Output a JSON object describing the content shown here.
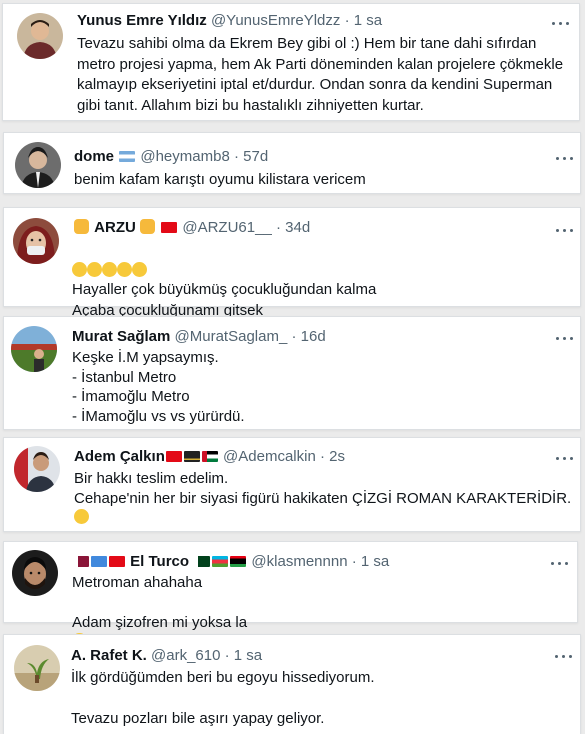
{
  "tweets": [
    {
      "name": "Yunus Emre Yıldız",
      "handle": "@YunusEmreYldzz",
      "time": "1 sa",
      "text": "Tevazu sahibi olma da Ekrem Bey gibi ol :) Hem bir tane dahi sıfırdan metro projesi yapma, hem Ak Parti döneminden kalan projelere çökmekle kalmayıp ekseriyetini iptal et/durdur. Ondan sonra da kendini Superman gibi tanıt. Allahım bizi bu hastalıklı zihniyetten kurtar."
    },
    {
      "name": "dome",
      "handle": "@heymamb8",
      "time": "57d",
      "text": "benim kafam karıştı oyumu kilistara vericem"
    },
    {
      "name": "ARZU",
      "handle": "@ARZU61__",
      "time": "34d",
      "text_line1": "Hayaller çok büyükmüş çocukluğundan kalma",
      "text_line2": "Açaba çocukluğunamı gitsek"
    },
    {
      "name": "Murat Sağlam",
      "handle": "@MuratSaglam_",
      "time": "16d",
      "text": "Keşke İ.M yapsaymış.\n- İstanbul Metro\n- İmamoğlu Metro\n- İMamoğlu vs vs yürürdü."
    },
    {
      "name": "Adem Çalkın",
      "handle": "@Ademcalkin",
      "time": "2s",
      "text": "Bir hakkı teslim edelim.\nCehape'nin her bir siyasi figürü hakikaten ÇİZGİ ROMAN KARAKTERİDİR."
    },
    {
      "name": "El Turco",
      "handle": "@klasmennnn",
      "time": "1 sa",
      "text_line1": "Metroman ahahaha",
      "text_line2": "Adam şizofren mi yoksa la"
    },
    {
      "name": "A. Rafet K.",
      "handle": "@ark_610",
      "time": "1 sa",
      "text_line1": "İlk gördüğümden beri bu egoyu hissediyorum.",
      "text_line2": "Tevazu pozları bile aşırı yapay geliyor."
    }
  ],
  "separator": "·",
  "colors": {
    "text": "#0f1419",
    "muted": "#536471",
    "background": "#ebebeb"
  }
}
